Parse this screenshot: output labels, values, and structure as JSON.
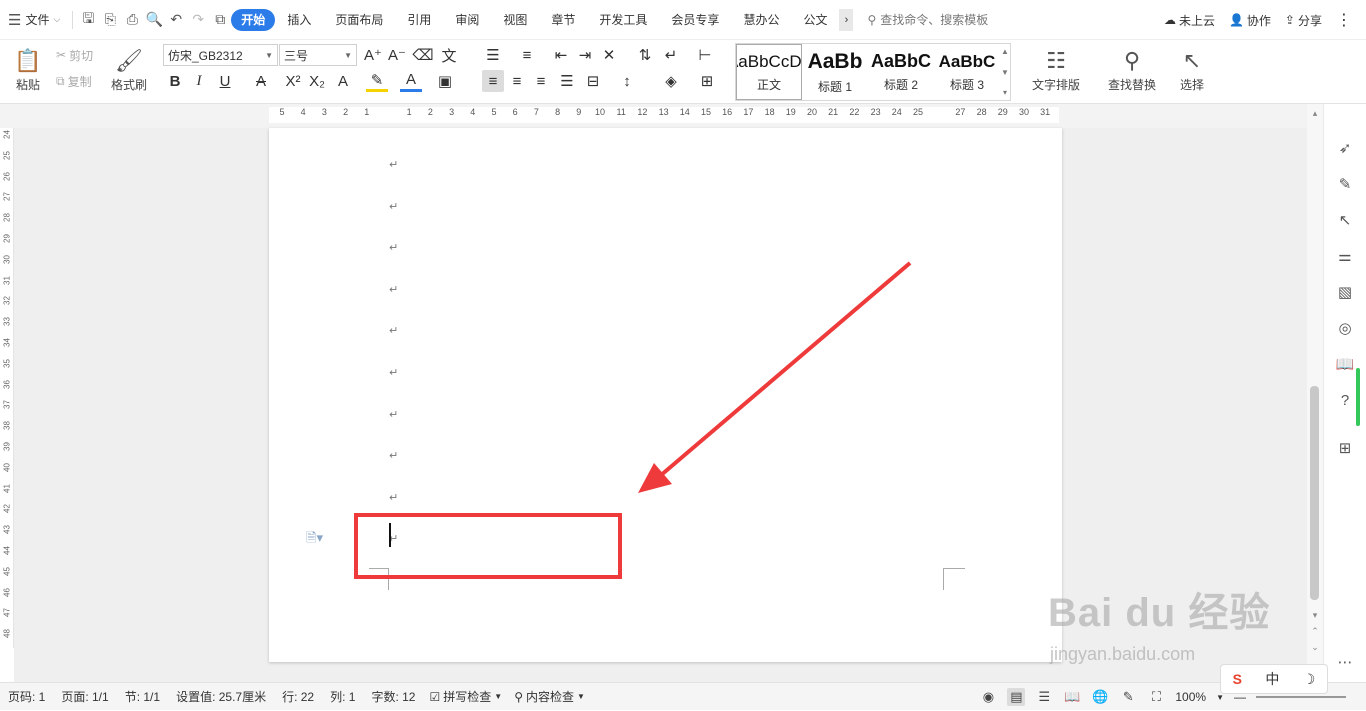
{
  "topbar": {
    "file_label": "文件",
    "tabs": [
      "开始",
      "插入",
      "页面布局",
      "引用",
      "审阅",
      "视图",
      "章节",
      "开发工具",
      "会员专享",
      "慧办公",
      "公文"
    ],
    "more_glyph": "›",
    "search_placeholder": "查找命令、搜索模板",
    "cloud_label": "未上云",
    "collab_label": "协作",
    "share_label": "分享"
  },
  "ribbon": {
    "paste_label": "粘贴",
    "cut_label": "剪切",
    "copy_label": "复制",
    "format_painter_label": "格式刷",
    "font_name": "仿宋_GB2312",
    "font_size": "三号",
    "styles": [
      {
        "sample": "AaBbCcDd",
        "name": "正文"
      },
      {
        "sample": "AaBb",
        "name": "标题 1"
      },
      {
        "sample": "AaBbC",
        "name": "标题 2"
      },
      {
        "sample": "AaBbC",
        "name": "标题 3"
      }
    ],
    "text_layout_label": "文字排版",
    "find_replace_label": "查找替换",
    "select_label": "选择"
  },
  "ruler": {
    "h_ticks": [
      "5",
      "4",
      "3",
      "2",
      "1",
      "",
      "1",
      "2",
      "3",
      "4",
      "5",
      "6",
      "7",
      "8",
      "9",
      "10",
      "11",
      "12",
      "13",
      "14",
      "15",
      "16",
      "17",
      "18",
      "19",
      "20",
      "21",
      "22",
      "23",
      "24",
      "25",
      "",
      "27",
      "28",
      "29",
      "30",
      "31"
    ],
    "v_ticks": [
      "24",
      "25",
      "26",
      "27",
      "28",
      "29",
      "30",
      "31",
      "32",
      "33",
      "34",
      "35",
      "36",
      "37",
      "38",
      "39",
      "40",
      "41",
      "42",
      "43",
      "44",
      "45",
      "46",
      "47",
      "48"
    ]
  },
  "document": {
    "para_mark": "↵",
    "para_count": 10
  },
  "statusbar": {
    "page_num": "页码: 1",
    "pages": "页面: 1/1",
    "section": "节: 1/1",
    "setting": "设置值: 25.7厘米",
    "row": "行: 22",
    "col": "列: 1",
    "word_count": "字数: 12",
    "spell_check": "拼写检查",
    "content_check": "内容检查",
    "zoom": "100%"
  },
  "ime": {
    "logo": "S",
    "mode": "中",
    "moon": "☽"
  },
  "watermark": {
    "brand": "Bai du 经验",
    "url": "jingyan.baidu.com"
  },
  "colors": {
    "accent": "#2b7ce9",
    "highlight_red": "#ee3a3a",
    "green": "#34c759"
  }
}
